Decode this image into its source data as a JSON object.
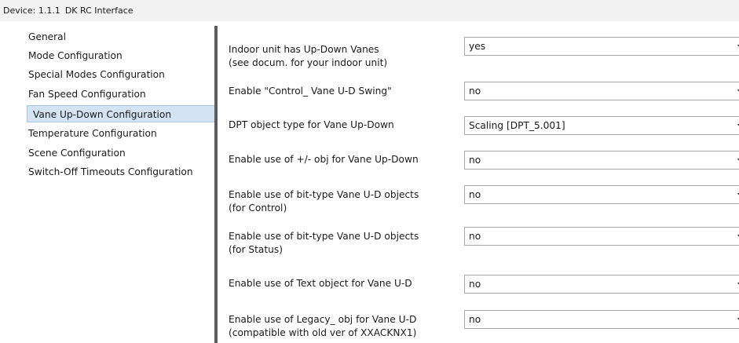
{
  "titlebar": {
    "device": "Device: 1.1.1",
    "name": "DK RC Interface"
  },
  "sidebar": {
    "items": [
      {
        "label": "General"
      },
      {
        "label": "Mode Configuration"
      },
      {
        "label": "Special Modes Configuration"
      },
      {
        "label": "Fan Speed Configuration"
      },
      {
        "label": "Vane Up-Down Configuration",
        "selected": true
      },
      {
        "label": "Temperature Configuration"
      },
      {
        "label": "Scene Configuration"
      },
      {
        "label": "Switch-Off Timeouts Configuration"
      }
    ]
  },
  "params": [
    {
      "label_line1": "Indoor unit has Up-Down Vanes",
      "label_line2": "(see docum. for your indoor unit)",
      "value": "yes"
    },
    {
      "label_line1": "Enable \"Control_ Vane U-D Swing\"",
      "label_line2": "",
      "value": "no"
    },
    {
      "label_line1": "DPT object type for Vane Up-Down",
      "label_line2": "",
      "value": "Scaling [DPT_5.001]"
    },
    {
      "label_line1": "Enable use of +/- obj for Vane Up-Down",
      "label_line2": "",
      "value": "no"
    },
    {
      "label_line1": "Enable use of bit-type Vane U-D objects",
      "label_line2": "(for Control)",
      "value": "no"
    },
    {
      "label_line1": "Enable use of bit-type Vane U-D objects",
      "label_line2": "(for Status)",
      "value": "no"
    },
    {
      "label_line1": "Enable use of Text object for Vane U-D",
      "label_line2": "",
      "value": "no"
    },
    {
      "label_line1": "Enable use of Legacy_ obj for Vane U-D",
      "label_line2": "(compatible with old ver of XXACKNX1)",
      "value": "no"
    }
  ],
  "icons": {
    "dropdown": "chevron-down-icon"
  },
  "colors": {
    "selection_bg": "#d3e3f4",
    "selection_border": "#a6c6e8",
    "splitter": "#5c5c5c",
    "titlebar_bg": "#f2f2f2"
  }
}
